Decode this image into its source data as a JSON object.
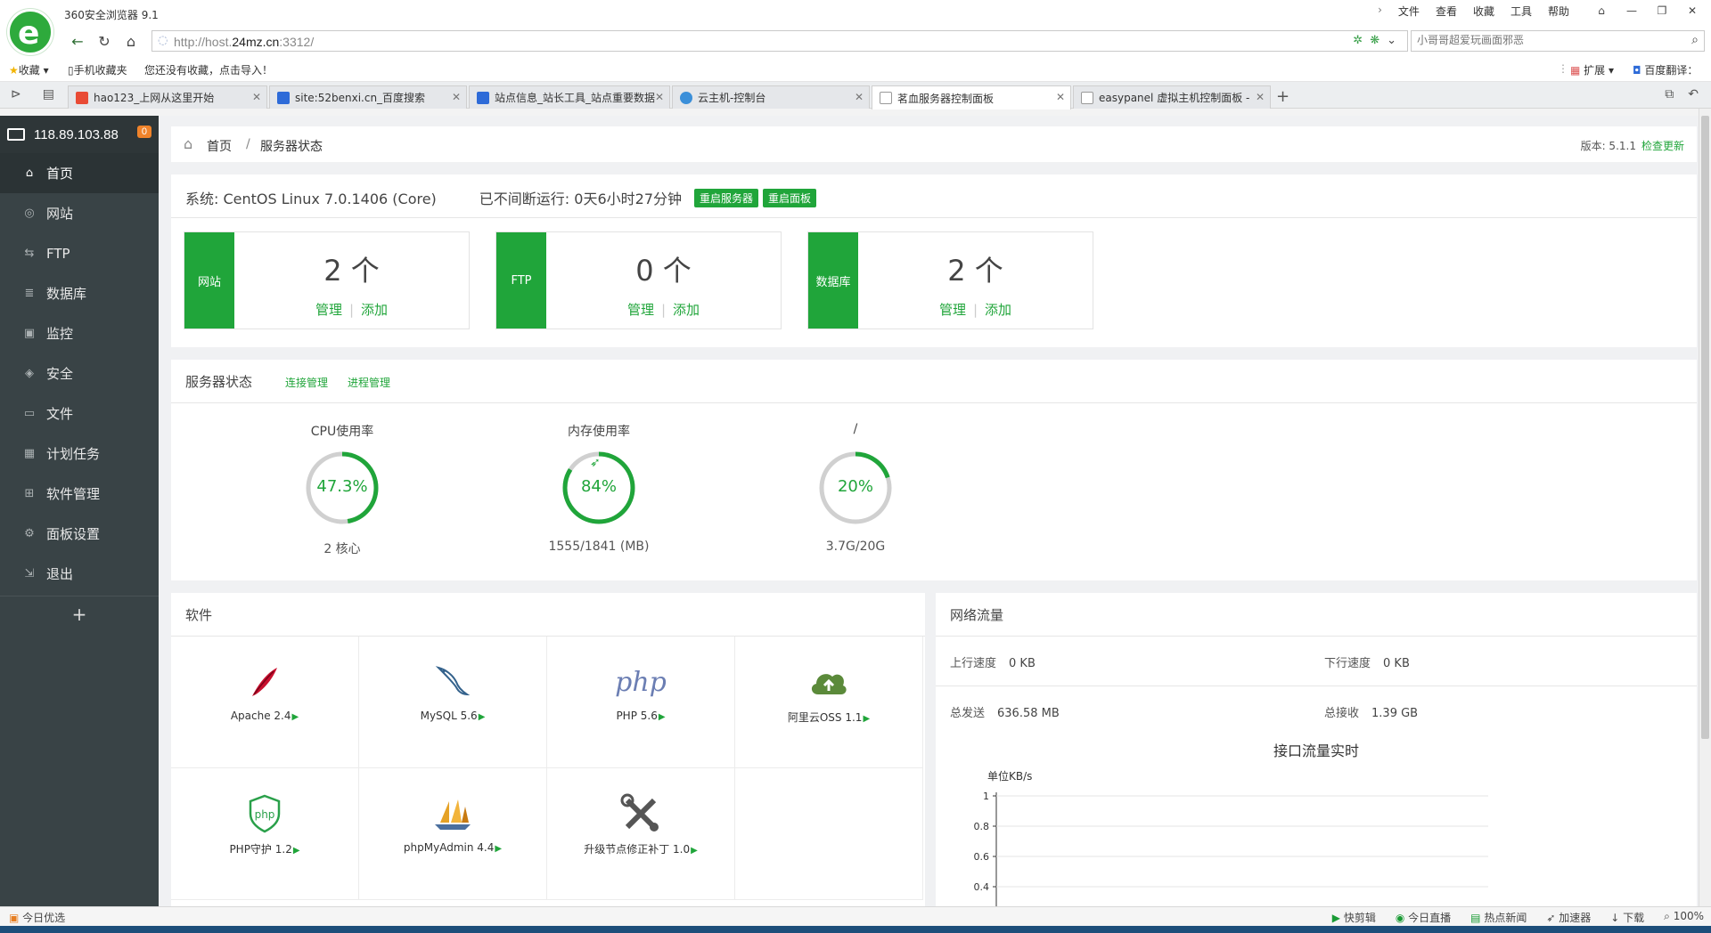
{
  "browser": {
    "title": "360安全浏览器 9.1",
    "logo_icon": "e-logo-icon",
    "menu": [
      "文件",
      "查看",
      "收藏",
      "工具",
      "帮助"
    ],
    "url_prefix": "http://host.",
    "url_domain": "24mz.cn",
    "url_suffix": ":3312/",
    "search_placeholder": "小哥哥超爱玩画面邪恶",
    "fav_label": "收藏",
    "fav_mobile": "手机收藏夹",
    "fav_hint": "您还没有收藏，点击导入！",
    "fav_ext": "扩展",
    "fav_translate": "百度翻译："
  },
  "tabs": [
    {
      "label": "hao123_上网从这里开始",
      "color": "#e94b35",
      "active": false
    },
    {
      "label": "site:52benxi.cn_百度搜索",
      "color": "#2e6bd8",
      "active": false
    },
    {
      "label": "站点信息_站长工具_站点重要数据",
      "color": "#2e6bd8",
      "active": false
    },
    {
      "label": "云主机-控制台",
      "color": "#3b8fd9",
      "active": false
    },
    {
      "label": "茗血服务器控制面板",
      "color": "#bbbbbb",
      "active": true
    },
    {
      "label": "easypanel 虚拟主机控制面板 - ",
      "color": "#bbbbbb",
      "active": false
    }
  ],
  "sidebar": {
    "ip": "118.89.103.88",
    "badge": "0",
    "items": [
      {
        "label": "首页",
        "icon": "home-icon",
        "glyph": "⌂"
      },
      {
        "label": "网站",
        "icon": "globe-icon",
        "glyph": "◎"
      },
      {
        "label": "FTP",
        "icon": "ftp-icon",
        "glyph": "⇆"
      },
      {
        "label": "数据库",
        "icon": "database-icon",
        "glyph": "≣"
      },
      {
        "label": "监控",
        "icon": "monitor-icon",
        "glyph": "▣"
      },
      {
        "label": "安全",
        "icon": "shield-icon",
        "glyph": "◈"
      },
      {
        "label": "文件",
        "icon": "folder-icon",
        "glyph": "▭"
      },
      {
        "label": "计划任务",
        "icon": "calendar-icon",
        "glyph": "▦"
      },
      {
        "label": "软件管理",
        "icon": "apps-icon",
        "glyph": "⊞"
      },
      {
        "label": "面板设置",
        "icon": "gear-icon",
        "glyph": "⚙"
      },
      {
        "label": "退出",
        "icon": "logout-icon",
        "glyph": "⇲"
      }
    ],
    "plus": "+"
  },
  "breadcrumb": {
    "home": "首页",
    "sep": "/",
    "current": "服务器状态",
    "version": "版本: 5.1.1",
    "check_update": "检查更新"
  },
  "system": {
    "os": "系统: CentOS Linux 7.0.1406 (Core)",
    "uptime": "已不间断运行: 0天6小时27分钟",
    "restart_server": "重启服务器",
    "restart_panel": "重启面板",
    "boxes": [
      {
        "label": "网站",
        "count": "2 个",
        "manage": "管理",
        "add": "添加"
      },
      {
        "label": "FTP",
        "count": "0 个",
        "manage": "管理",
        "add": "添加"
      },
      {
        "label": "数据库",
        "count": "2 个",
        "manage": "管理",
        "add": "添加"
      }
    ]
  },
  "status": {
    "title": "服务器状态",
    "link_conn": "连接管理",
    "link_proc": "进程管理",
    "gauges": [
      {
        "title": "CPU使用率",
        "value": "47.3%",
        "fraction": 0.473,
        "sub": "2 核心"
      },
      {
        "title": "内存使用率",
        "value": "84%",
        "fraction": 0.84,
        "sub": "1555/1841 (MB)"
      },
      {
        "title": "/",
        "value": "20%",
        "fraction": 0.2,
        "sub": "3.7G/20G"
      }
    ],
    "rocket_icon": "rocket-icon"
  },
  "software": {
    "title": "软件",
    "items": [
      {
        "name": "Apache 2.4",
        "icon": "apache-feather-icon"
      },
      {
        "name": "MySQL 5.6",
        "icon": "mysql-dolphin-icon"
      },
      {
        "name": "PHP 5.6",
        "icon": "php-logo-icon"
      },
      {
        "name": "阿里云OSS 1.1",
        "icon": "cloud-upload-icon"
      },
      {
        "name": "PHP守护 1.2",
        "icon": "php-shield-icon"
      },
      {
        "name": "phpMyAdmin 4.4",
        "icon": "sailboat-icon"
      },
      {
        "name": "升级节点修正补丁 1.0",
        "icon": "tools-icon"
      }
    ]
  },
  "network": {
    "title": "网络流量",
    "up_label": "上行速度",
    "up_value": "0 KB",
    "down_label": "下行速度",
    "down_value": "0 KB",
    "sent_label": "总发送",
    "sent_value": "636.58 MB",
    "recv_label": "总接收",
    "recv_value": "1.39 GB"
  },
  "chart_data": {
    "type": "line",
    "title": "接口流量实时",
    "ylabel": "单位KB/s",
    "yticks": [
      1,
      0.8,
      0.6,
      0.4
    ],
    "ylim": [
      0,
      1
    ],
    "series": []
  },
  "statusbar": {
    "left": "今日优选",
    "right": [
      "快剪辑",
      "今日直播",
      "热点新闻",
      "加速器",
      "下载",
      "100%"
    ]
  }
}
